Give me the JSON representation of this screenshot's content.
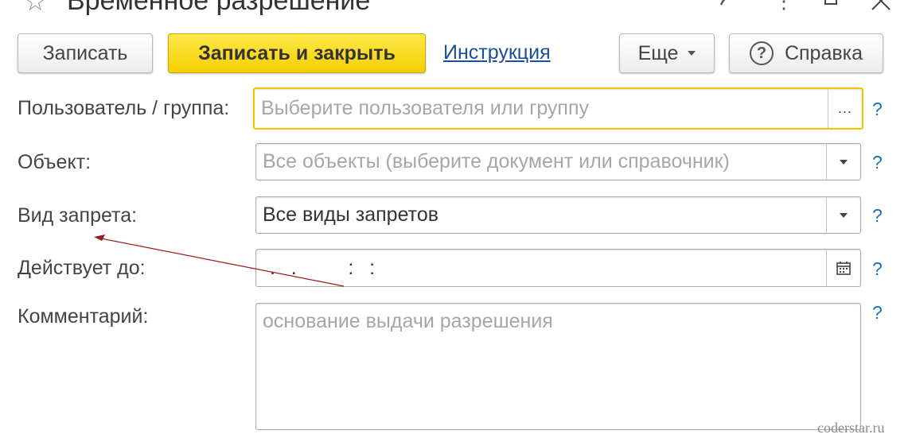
{
  "window": {
    "title": "Временное разрешение",
    "icons": [
      "star-icon",
      "link-icon",
      "more-vertical-icon",
      "maximize-icon",
      "close-icon"
    ]
  },
  "toolbar": {
    "save_label": "Записать",
    "save_close_label": "Записать и закрыть",
    "instruction_label": "Инструкция",
    "more_label": "Еще",
    "help_label": "Справка"
  },
  "form": {
    "user": {
      "label": "Пользователь / группа:",
      "value": "",
      "placeholder": "Выберите пользователя или группу",
      "button": "..."
    },
    "object": {
      "label": "Объект:",
      "value": "",
      "placeholder": "Все объекты (выберите документ или справочник)"
    },
    "restriction_kind": {
      "label": "Вид запрета:",
      "value": "Все виды запретов",
      "placeholder": ""
    },
    "valid_until": {
      "label": "Действует до:",
      "value": " .  .       :  :",
      "placeholder": ""
    },
    "comment": {
      "label": "Комментарий:",
      "value": "",
      "placeholder": "основание выдачи разрешения"
    },
    "help_mark": "?"
  },
  "colors": {
    "accent_yellow": "#f5cf00",
    "focus_border": "#f2c400",
    "link_blue": "#1a4f9a",
    "help_blue": "#1c6eb5",
    "annotation_arrow": "#9b1c1c"
  },
  "watermark": "coderstar.ru"
}
